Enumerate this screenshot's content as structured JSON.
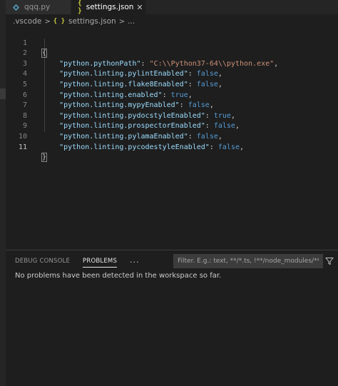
{
  "tabs": [
    {
      "label": "qqq.py",
      "icon": "python-file-icon"
    },
    {
      "label": "settings.json",
      "icon": "json-file-icon",
      "close": "✕"
    }
  ],
  "breadcrumb": {
    "folder": ".vscode",
    "separator": ">",
    "file": "settings.json",
    "tail": "..."
  },
  "editor": {
    "line_numbers": [
      "1",
      "2",
      "3",
      "4",
      "5",
      "6",
      "7",
      "8",
      "9",
      "10",
      "11"
    ],
    "lines": [
      {
        "open": "{"
      },
      {
        "key": "\"python.pythonPath\"",
        "colon": ": ",
        "value": "\"C:\\\\Python37-64\\\\python.exe\"",
        "comma": ","
      },
      {
        "key": "\"python.linting.pylintEnabled\"",
        "colon": ": ",
        "value": "false",
        "comma": ","
      },
      {
        "key": "\"python.linting.flake8Enabled\"",
        "colon": ": ",
        "value": "false",
        "comma": ","
      },
      {
        "key": "\"python.linting.enabled\"",
        "colon": ": ",
        "value": "true",
        "comma": ","
      },
      {
        "key": "\"python.linting.mypyEnabled\"",
        "colon": ": ",
        "value": "false",
        "comma": ","
      },
      {
        "key": "\"python.linting.pydocstyleEnabled\"",
        "colon": ": ",
        "value": "true",
        "comma": ","
      },
      {
        "key": "\"python.linting.prospectorEnabled\"",
        "colon": ": ",
        "value": "false",
        "comma": ","
      },
      {
        "key": "\"python.linting.pylamaEnabled\"",
        "colon": ": ",
        "value": "false",
        "comma": ","
      },
      {
        "key": "\"python.linting.pycodestyleEnabled\"",
        "colon": ": ",
        "value": "false",
        "comma": ","
      },
      {
        "close": "}"
      }
    ]
  },
  "panel": {
    "tabs": [
      "DEBUG CONSOLE",
      "PROBLEMS"
    ],
    "active_tab": "PROBLEMS",
    "more": "···",
    "filter_placeholder": "Filter. E.g.: text, **/*.ts, !**/node_modules/**",
    "message": "No problems have been detected in the workspace so far."
  },
  "colors": {
    "background": "#1e1e1e",
    "json_key": "#9cdcfe",
    "json_string": "#ce9178",
    "json_boolean": "#569cd6",
    "json_icon": "#cbcb41"
  }
}
